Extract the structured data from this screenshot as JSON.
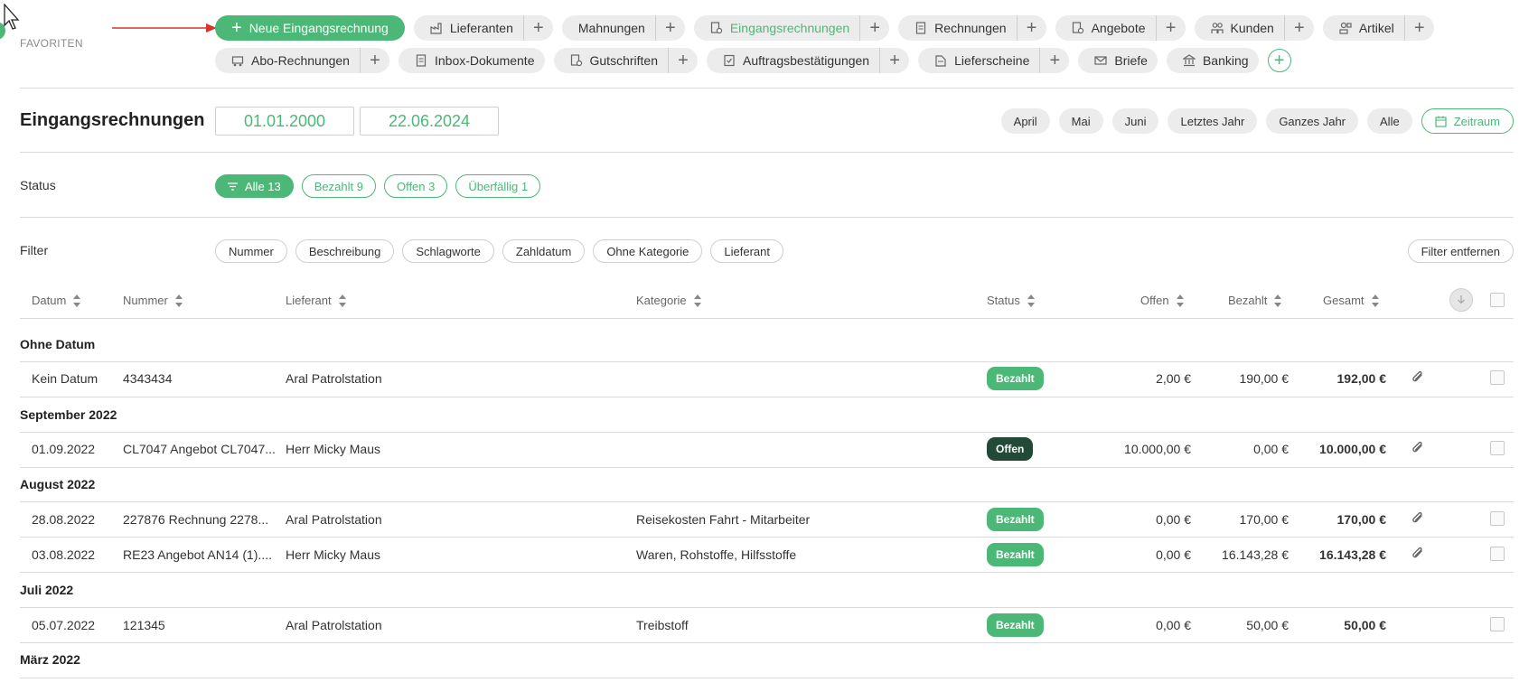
{
  "favorites": {
    "label": "FAVORITEN",
    "primary_action": "Neue Eingangsrechnung",
    "row1": [
      {
        "label": "Lieferanten",
        "icon": "factory-icon"
      },
      {
        "label": "Mahnungen",
        "icon": ""
      },
      {
        "label": "Eingangsrechnungen",
        "icon": "invoice-search-icon",
        "active": true
      },
      {
        "label": "Rechnungen",
        "icon": "document-icon"
      },
      {
        "label": "Angebote",
        "icon": "offer-icon"
      },
      {
        "label": "Kunden",
        "icon": "customers-icon"
      },
      {
        "label": "Artikel",
        "icon": "article-icon"
      }
    ],
    "row2": [
      {
        "label": "Abo-Rechnungen",
        "icon": "subscription-icon"
      },
      {
        "label": "Inbox-Dokumente",
        "icon": "inbox-icon"
      },
      {
        "label": "Gutschriften",
        "icon": "credit-note-icon"
      },
      {
        "label": "Auftragsbestätigungen",
        "icon": "order-confirmation-icon"
      },
      {
        "label": "Lieferscheine",
        "icon": "delivery-note-icon"
      },
      {
        "label": "Briefe",
        "icon": "mail-icon"
      },
      {
        "label": "Banking",
        "icon": "bank-icon"
      }
    ]
  },
  "page": {
    "title": "Eingangsrechnungen",
    "date_from": "01.01.2000",
    "date_to": "22.06.2024",
    "periods": [
      "April",
      "Mai",
      "Juni",
      "Letztes Jahr",
      "Ganzes Jahr",
      "Alle"
    ],
    "period_custom": "Zeitraum"
  },
  "status": {
    "label": "Status",
    "options": [
      "Alle 13",
      "Bezahlt 9",
      "Offen 3",
      "Überfällig 1"
    ]
  },
  "filter": {
    "label": "Filter",
    "options": [
      "Nummer",
      "Beschreibung",
      "Schlagworte",
      "Zahldatum",
      "Ohne Kategorie",
      "Lieferant"
    ],
    "remove": "Filter entfernen"
  },
  "table": {
    "columns": {
      "datum": "Datum",
      "nummer": "Nummer",
      "lieferant": "Lieferant",
      "kategorie": "Kategorie",
      "status": "Status",
      "offen": "Offen",
      "bezahlt": "Bezahlt",
      "gesamt": "Gesamt"
    },
    "groups": [
      {
        "title": "Ohne Datum",
        "rows": [
          {
            "datum": "Kein Datum",
            "nummer": "4343434",
            "lieferant": "Aral Patrolstation",
            "kategorie": "",
            "status": "Bezahlt",
            "offen": "2,00 €",
            "bezahlt": "190,00 €",
            "gesamt": "192,00 €",
            "attachment": true
          }
        ]
      },
      {
        "title": "September 2022",
        "rows": [
          {
            "datum": "01.09.2022",
            "nummer": "CL7047 Angebot CL7047...",
            "lieferant": "Herr Micky Maus",
            "kategorie": "",
            "status": "Offen",
            "offen": "10.000,00 €",
            "bezahlt": "0,00 €",
            "gesamt": "10.000,00 €",
            "attachment": true
          }
        ]
      },
      {
        "title": "August 2022",
        "rows": [
          {
            "datum": "28.08.2022",
            "nummer": "227876 Rechnung 2278...",
            "lieferant": "Aral Patrolstation",
            "kategorie": "Reisekosten Fahrt - Mitarbeiter",
            "status": "Bezahlt",
            "offen": "0,00 €",
            "bezahlt": "170,00 €",
            "gesamt": "170,00 €",
            "attachment": true
          },
          {
            "datum": "03.08.2022",
            "nummer": "RE23 Angebot AN14 (1)....",
            "lieferant": "Herr Micky Maus",
            "kategorie": "Waren, Rohstoffe, Hilfsstoffe",
            "status": "Bezahlt",
            "offen": "0,00 €",
            "bezahlt": "16.143,28 €",
            "gesamt": "16.143,28 €",
            "attachment": true
          }
        ]
      },
      {
        "title": "Juli 2022",
        "rows": [
          {
            "datum": "05.07.2022",
            "nummer": "121345",
            "lieferant": "Aral Patrolstation",
            "kategorie": "Treibstoff",
            "status": "Bezahlt",
            "offen": "0,00 €",
            "bezahlt": "50,00 €",
            "gesamt": "50,00 €",
            "attachment": false
          }
        ]
      },
      {
        "title": "März 2022",
        "rows": []
      }
    ]
  },
  "colors": {
    "accent": "#4cb877",
    "open_badge": "#234a38",
    "chip_bg": "#ececec"
  }
}
